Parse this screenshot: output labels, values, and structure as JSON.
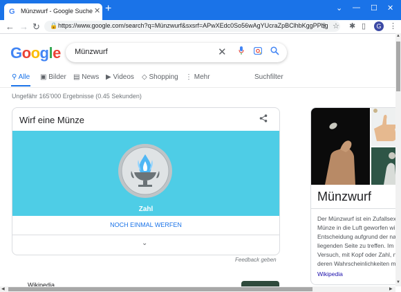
{
  "browser": {
    "tab_title": "Münzwurf - Google Suche",
    "favicon": "G",
    "url": "https://www.google.com/search?q=Münzwurf&sxsrf=APwXEdc0So56wAgYUcraZpBClhbKggPPbg%...",
    "new_tab": "+",
    "tab_close": "✕",
    "avatar_letter": "G"
  },
  "search": {
    "logo": [
      "G",
      "o",
      "o",
      "g",
      "l",
      "e"
    ],
    "logo_colors": [
      "#4285f4",
      "#ea4335",
      "#fbbc05",
      "#4285f4",
      "#34a853",
      "#ea4335"
    ],
    "query": "Münzwurf",
    "tabs": [
      "Alle",
      "Bilder",
      "News",
      "Videos",
      "Shopping",
      "Mehr"
    ],
    "tools": "Suchfilter",
    "result_stats": "Ungefähr 165'000 Ergebnisse (0.45 Sekunden)"
  },
  "coin_card": {
    "title": "Wirf eine Münze",
    "result_label": "Zahl",
    "flip_again": "NOCH EINMAL WERFEN",
    "feedback": "Feedback geben",
    "accent_color": "#4ecde6"
  },
  "next_result": {
    "source": "Wikipedia"
  },
  "knowledge_panel": {
    "title": "Münzwurf",
    "lines": [
      "Der Münzwurf ist ein Zufallsex",
      "Münze in die Luft geworfen wi",
      "Entscheidung aufgrund der na",
      "liegenden Seite zu treffen. Im",
      "Versuch, mit Kopf oder Zahl, n",
      "deren Wahrscheinlichkeiten m"
    ],
    "source_link": "Wikipedia"
  },
  "colors": {
    "brand_blue": "#1a73e8",
    "link_blue": "#1a0dab"
  }
}
